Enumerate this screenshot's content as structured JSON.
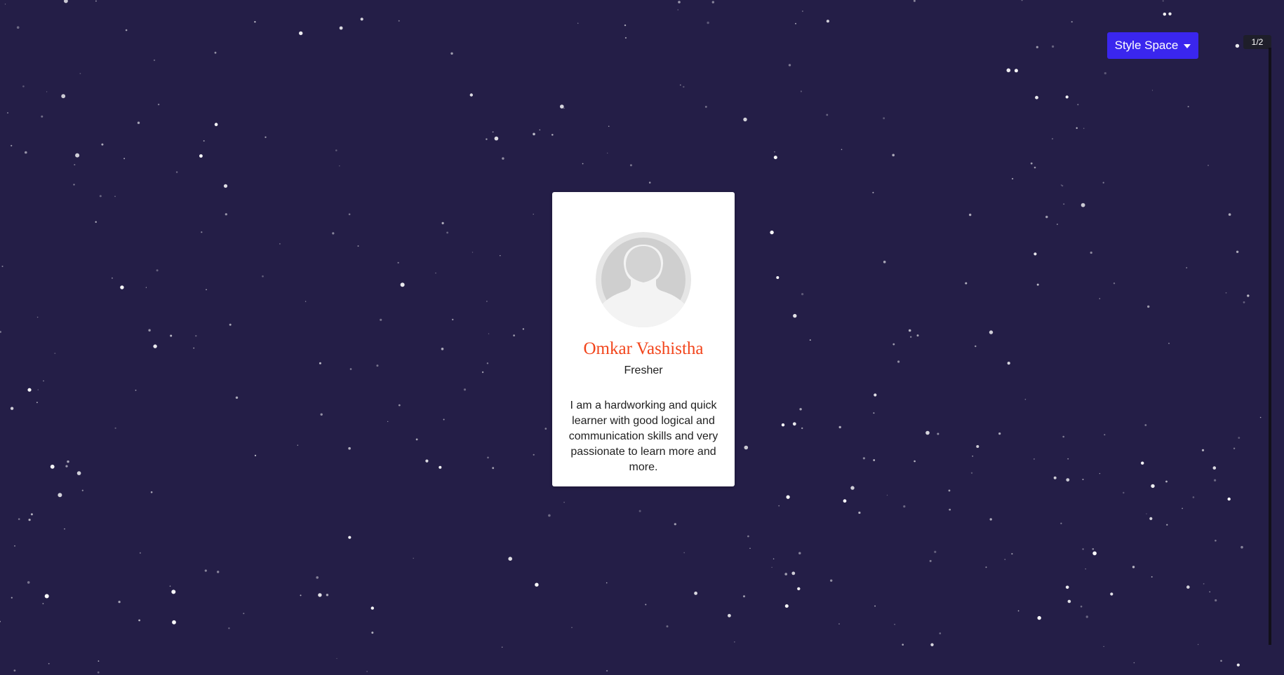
{
  "header": {
    "style_button_label": "Style Space",
    "style_button_icon": "chevron-down-icon",
    "page_indicator": "1/2"
  },
  "profile": {
    "name": "Omkar Vashistha",
    "role": "Fresher",
    "bio": "I am a hardworking and quick learner with good logical and communication skills and very passionate to learn more and more.",
    "avatar_icon": "default-user-avatar-icon"
  },
  "colors": {
    "background": "#241e47",
    "accent_button": "#3a26ee",
    "name_color": "#f2451c",
    "card_background": "#ffffff"
  }
}
